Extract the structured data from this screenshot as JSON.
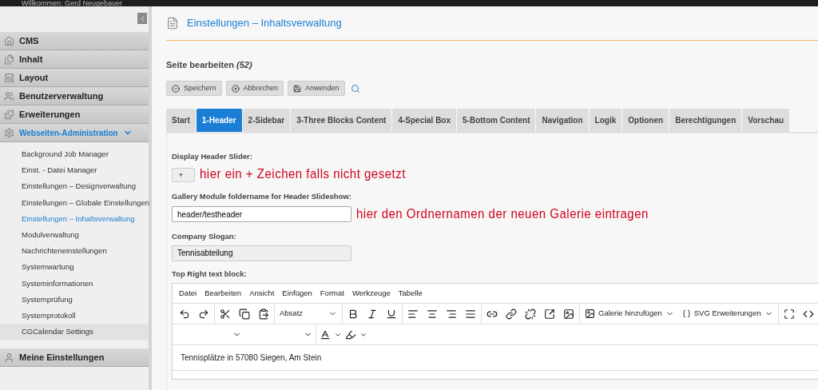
{
  "top_bar": {
    "welcome": "Willkommen: Gerd Neugebauer"
  },
  "sidebar": {
    "items": [
      {
        "label": "CMS",
        "expanded": false
      },
      {
        "label": "Inhalt",
        "expanded": false
      },
      {
        "label": "Layout",
        "expanded": false
      },
      {
        "label": "Benutzerverwaltung",
        "expanded": false
      },
      {
        "label": "Erweiterungen",
        "expanded": false
      },
      {
        "label": "Webseiten-Administration",
        "expanded": true,
        "children": [
          {
            "label": "Background Job Manager",
            "selected": false,
            "hovered": false
          },
          {
            "label": "Einst. - Datei Manager",
            "selected": false,
            "hovered": false
          },
          {
            "label": "Einstellungen – Designverwaltung",
            "selected": false,
            "hovered": false
          },
          {
            "label": "Einstellungen – Globale Einstellungen",
            "selected": false,
            "hovered": false
          },
          {
            "label": "Einstellungen – Inhaltsverwaltung",
            "selected": true,
            "hovered": false
          },
          {
            "label": "Modulverwaltung",
            "selected": false,
            "hovered": false
          },
          {
            "label": "Nachrichteneinstellungen",
            "selected": false,
            "hovered": false
          },
          {
            "label": "Systemwartung",
            "selected": false,
            "hovered": false
          },
          {
            "label": "Systeminformationen",
            "selected": false,
            "hovered": false
          },
          {
            "label": "Systemprüfung",
            "selected": false,
            "hovered": false
          },
          {
            "label": "Systemprotokoll",
            "selected": false,
            "hovered": false
          },
          {
            "label": "CGCalendar Settings",
            "selected": false,
            "hovered": true
          }
        ]
      },
      {
        "label": "Meine Einstellungen",
        "expanded": false
      }
    ]
  },
  "page": {
    "title": "Einstellungen – Inhaltsverwaltung",
    "subtitle": "Seite bearbeiten",
    "subtitle_count": "(52)",
    "buttons": [
      {
        "label": "Speichern",
        "kind": "check"
      },
      {
        "label": "Abbrechen",
        "kind": "cancel"
      },
      {
        "label": "Anwenden",
        "kind": "apply"
      }
    ]
  },
  "tabs": [
    {
      "label": "Start",
      "selected": false
    },
    {
      "label": "1-Header",
      "selected": true
    },
    {
      "label": "2-Sidebar",
      "selected": false
    },
    {
      "label": "3-Three Blocks Content",
      "selected": false
    },
    {
      "label": "4-Special Box",
      "selected": false
    },
    {
      "label": "5-Bottom Content",
      "selected": false
    },
    {
      "label": "Navigation",
      "selected": false
    },
    {
      "label": "Logik",
      "selected": false
    },
    {
      "label": "Optionen",
      "selected": false
    },
    {
      "label": "Berechtigungen",
      "selected": false
    },
    {
      "label": "Vorschau",
      "selected": false
    }
  ],
  "form": {
    "fields": [
      {
        "label": "Display Header Slider:",
        "kind": "small",
        "value": "+",
        "annotation": "hier ein + Zeichen falls nicht gesetzt"
      },
      {
        "label": "Gallery Module foldername for Header Slideshow:",
        "kind": "text",
        "value": "header/testheader",
        "annotation": "hier den Ordnernamen der neuen Galerie eintragen"
      },
      {
        "label": "Company Slogan:",
        "kind": "readonly",
        "value": "Tennisabteilung"
      }
    ],
    "editor": {
      "label": "Top Right text block:",
      "menu": [
        "Datei",
        "Bearbeiten",
        "Ansicht",
        "Einfügen",
        "Format",
        "Werkzeuge",
        "Tabelle"
      ],
      "block_format": "Absatz",
      "gallery_button": "Galerie hinzufügen",
      "svg_button": "SVG Erweiterungen",
      "content": "Tennisplätze in 57080 Siegen, Am Stein"
    }
  }
}
